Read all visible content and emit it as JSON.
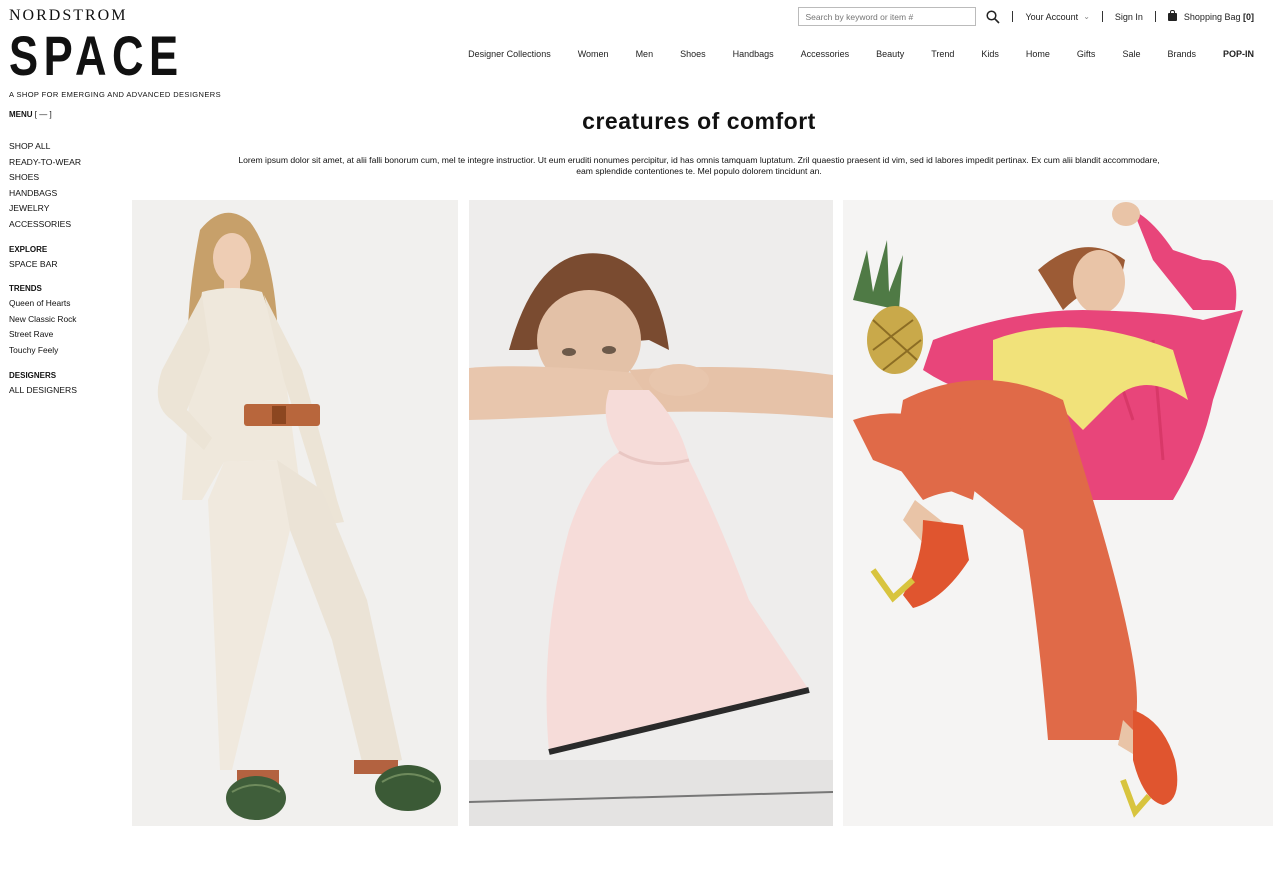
{
  "brand": {
    "name": "NORDSTROM",
    "sub": "SPACE",
    "tagline": "A SHOP FOR EMERGING AND ADVANCED DESIGNERS"
  },
  "utility": {
    "search_placeholder": "Search by keyword or item #",
    "account": "Your Account",
    "sign_in": "Sign In",
    "bag": "Shopping Bag",
    "bag_count": "[0]"
  },
  "nav": [
    "Designer Collections",
    "Women",
    "Men",
    "Shoes",
    "Handbags",
    "Accessories",
    "Beauty",
    "Trend",
    "Kids",
    "Home",
    "Gifts",
    "Sale",
    "Brands",
    "POP-IN"
  ],
  "sidebar": {
    "menu_label": "MENU",
    "menu_toggle": "[ — ]",
    "categories": [
      "SHOP ALL",
      "READY-TO-WEAR",
      "SHOES",
      "HANDBAGS",
      "JEWELRY",
      "ACCESSORIES"
    ],
    "explore_head": "EXPLORE",
    "explore": [
      "SPACE BAR"
    ],
    "trends_head": "TRENDS",
    "trends": [
      "Queen of Hearts",
      "New Classic Rock",
      "Street Rave",
      "Touchy Feely"
    ],
    "designers_head": "DESIGNERS",
    "designers": [
      "ALL DESIGNERS"
    ]
  },
  "main": {
    "title": "creatures of comfort",
    "intro": "Lorem ipsum dolor sit amet, at alii falli bonorum cum, mel te integre instructior. Ut eum eruditi nonumes percipitur, id has omnis tamquam luptatum. Zril quaestio praesent id vim, sed id labores impedit pertinax. Ex cum alii blandit accommodare, eam splendide contentiones te. Mel populo dolorem tincidunt an."
  },
  "colors": {
    "text": "#111111",
    "cream": "#efe8dc",
    "pink_bag": "#f6dcd9",
    "pink_top": "#e8457a",
    "orange_pants": "#e06a48",
    "yellow_sweater": "#f1e27a"
  }
}
